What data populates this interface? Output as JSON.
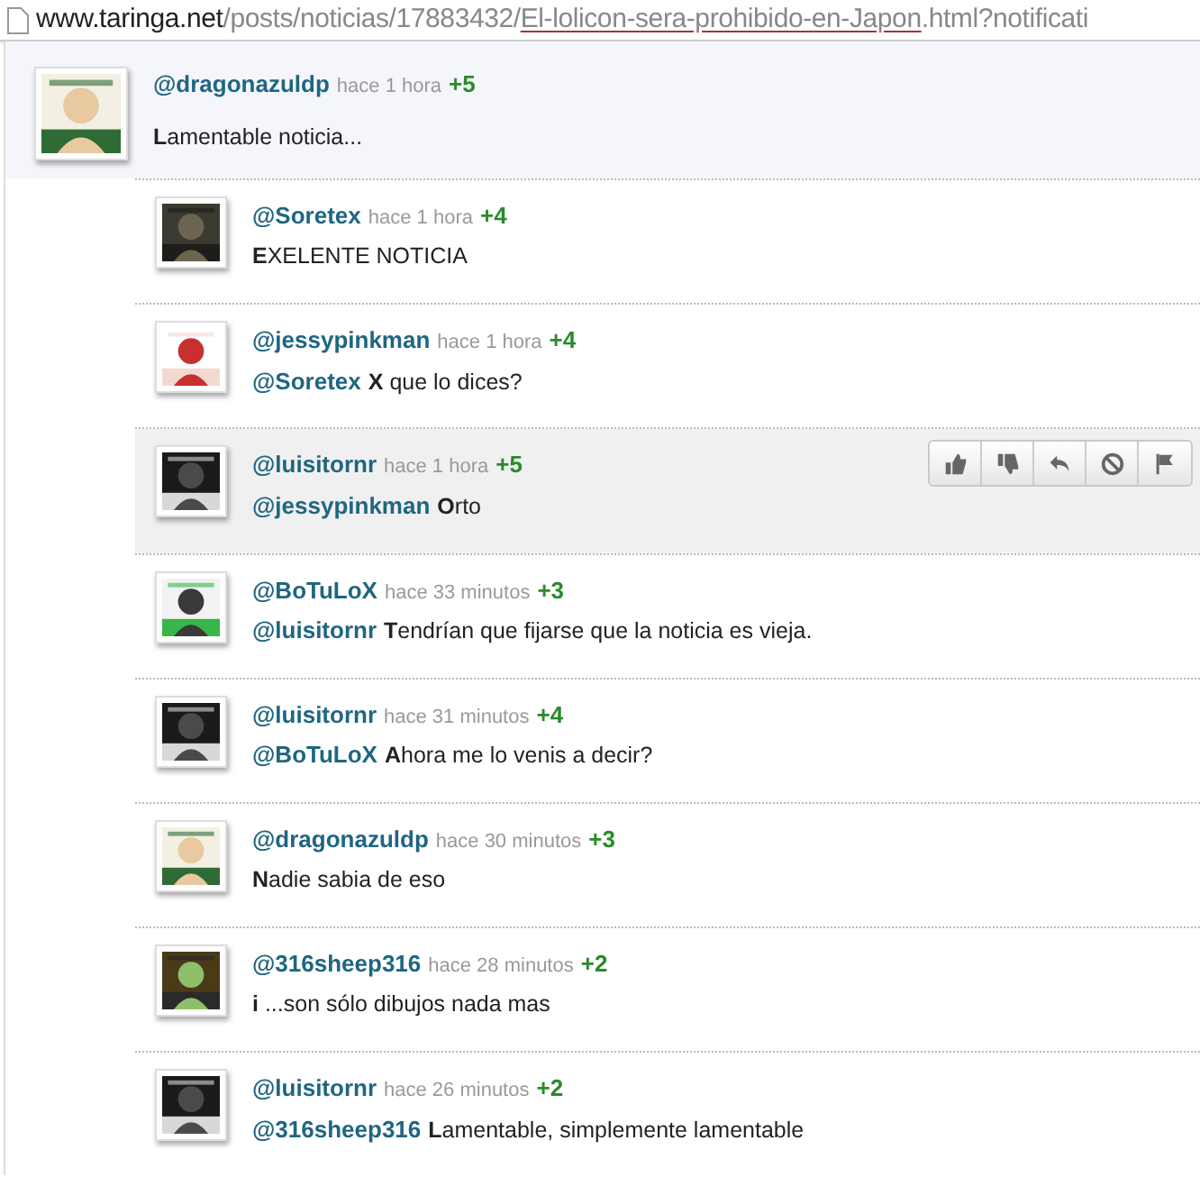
{
  "address_bar": {
    "domain": "www.taringa.net",
    "path": "/posts/noticias/17883432/",
    "link": "El-lolicon-sera-prohibido-en-Japon",
    "rest": ".html?notificati"
  },
  "comments": [
    {
      "kind": "comment",
      "hovered": false,
      "user": "@dragonazuldp",
      "time": "hace 1 hora",
      "votes": "+5",
      "text": "**L**amentable noticia..."
    },
    {
      "kind": "reply",
      "hovered": false,
      "user": "@Soretex",
      "time": "hace 1 hora",
      "votes": "+4",
      "text": "**E**XELENTE NOTICIA"
    },
    {
      "kind": "reply",
      "hovered": false,
      "user": "@jessypinkman",
      "time": "hace 1 hora",
      "votes": "+4",
      "mention": "@Soretex",
      "text": "**X** que lo dices?"
    },
    {
      "kind": "reply",
      "hovered": true,
      "user": "@luisitornr",
      "time": "hace 1 hora",
      "votes": "+5",
      "mention": "@jessypinkman",
      "text": "**O**rto"
    },
    {
      "kind": "reply",
      "hovered": false,
      "user": "@BoTuLoX",
      "time": "hace 33 minutos",
      "votes": "+3",
      "mention": "@luisitornr",
      "text": "**T**endrían que fijarse que la noticia es vieja."
    },
    {
      "kind": "reply",
      "hovered": false,
      "user": "@luisitornr",
      "time": "hace 31 minutos",
      "votes": "+4",
      "mention": "@BoTuLoX",
      "text": "**A**hora me lo venis a decir?"
    },
    {
      "kind": "reply",
      "hovered": false,
      "user": "@dragonazuldp",
      "time": "hace 30 minutos",
      "votes": "+3",
      "text": "**N**adie sabia de eso"
    },
    {
      "kind": "reply",
      "hovered": false,
      "user": "@316sheep316",
      "time": "hace 28 minutos",
      "votes": "+2",
      "text": "**i** ...son sólo dibujos nada mas"
    },
    {
      "kind": "reply",
      "hovered": false,
      "user": "@luisitornr",
      "time": "hace 26 minutos",
      "votes": "+2",
      "mention": "@316sheep316",
      "text": "**L**amentable, simplemente lamentable"
    }
  ]
}
